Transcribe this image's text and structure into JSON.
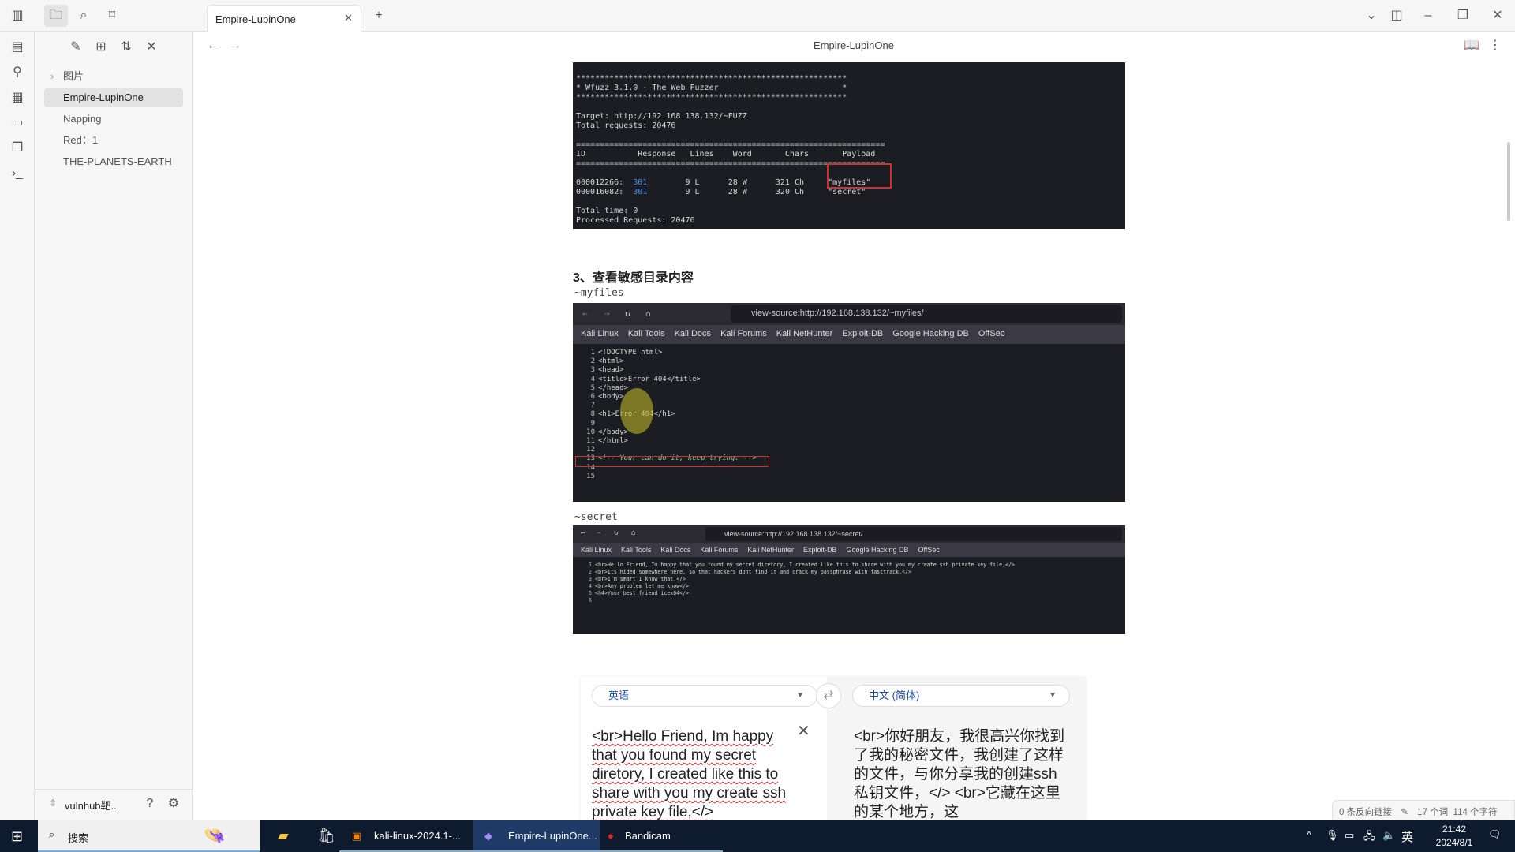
{
  "window": {
    "tab_title": "Empire-LupinOne",
    "doc_title": "Empire-LupinOne"
  },
  "sidebar": {
    "items": [
      {
        "label": "图片",
        "folder": true
      },
      {
        "label": "Empire-LupinOne",
        "active": true
      },
      {
        "label": "Napping"
      },
      {
        "label": "Red：1"
      },
      {
        "label": "THE-PLANETS-EARTH"
      }
    ],
    "vault": "vulnhub靶..."
  },
  "content": {
    "wfuzz": {
      "stars": "*********************************************************",
      "banner": "* Wfuzz 3.1.0 - The Web Fuzzer                          *",
      "target": "Target: http://192.168.138.132/~FUZZ",
      "total": "Total requests: 20476",
      "sep": "=================================================================",
      "header": "ID           Response   Lines    Word       Chars       Payload",
      "rows": [
        {
          "id": "000012266:",
          "resp": "301",
          "lines": "9 L",
          "word": "28 W",
          "chars": "321 Ch",
          "payload": "\"myfiles\""
        },
        {
          "id": "000016082:",
          "resp": "301",
          "lines": "9 L",
          "word": "28 W",
          "chars": "320 Ch",
          "payload": "\"secret\""
        }
      ],
      "time": "Total time: 0",
      "processed": "Processed Requests: 20476"
    },
    "heading": "3、查看敏感目录内容",
    "myfiles_label": "~myfiles",
    "secret_label": "~secret",
    "browser": {
      "bookmarks": [
        "Kali Linux",
        "Kali Tools",
        "Kali Docs",
        "Kali Forums",
        "Kali NetHunter",
        "Exploit-DB",
        "Google Hacking DB",
        "OffSec"
      ],
      "myfiles_url": "view-source:http://192.168.138.132/~myfiles/",
      "secret_url": "view-source:http://192.168.138.132/~secret/",
      "myfiles_lines": [
        [
          "1",
          "<!DOCTYPE html>"
        ],
        [
          "2",
          "<html>"
        ],
        [
          "3",
          "<head>"
        ],
        [
          "4",
          "<title>Error 404</title>"
        ],
        [
          "5",
          "</head>"
        ],
        [
          "6",
          "<body>"
        ],
        [
          "7",
          ""
        ],
        [
          "8",
          "<h1>Error 404</h1>"
        ],
        [
          "9",
          ""
        ],
        [
          "10",
          "</body>"
        ],
        [
          "11",
          "</html>"
        ],
        [
          "12",
          ""
        ],
        [
          "13",
          "<!-- Your can do it, keep trying. -->"
        ],
        [
          "14",
          ""
        ],
        [
          "15",
          ""
        ]
      ],
      "secret_lines": [
        [
          "1",
          "<br>Hello Friend, Im happy that you found my secret diretory, I created like this to share with you my create ssh private key file,</>"
        ],
        [
          "2",
          "<br>Its hided somewhere here, so that hackers dont find it and crack my passphrase with fasttrack.</>"
        ],
        [
          "3",
          "<br>I'm smart I know that.</>"
        ],
        [
          "4",
          "<br>Any problem let me know</>"
        ],
        [
          "5",
          "<h4>Your best friend icex64</>"
        ],
        [
          "6",
          ""
        ]
      ]
    },
    "translate": {
      "source_lang": "英语",
      "target_lang": "中文 (简体)",
      "source_text": "<br>Hello Friend, Im happy that you found my secret diretory, I created like this to share with you my create ssh private key file,</>",
      "target_text": "<br>你好朋友，我很高兴你找到了我的秘密文件，我创建了这样的文件，与你分享我的创建ssh私钥文件，</> <br>它藏在这里的某个地方，这"
    }
  },
  "status": {
    "backlinks": "0 条反向链接",
    "words": "17 个词",
    "chars": "114 个字符"
  },
  "taskbar": {
    "search": "搜索",
    "apps": [
      "kali-linux-2024.1-...",
      "Empire-LupinOne...",
      "Bandicam"
    ],
    "ime": "英",
    "time": "21:42",
    "date": "2024/8/1"
  }
}
